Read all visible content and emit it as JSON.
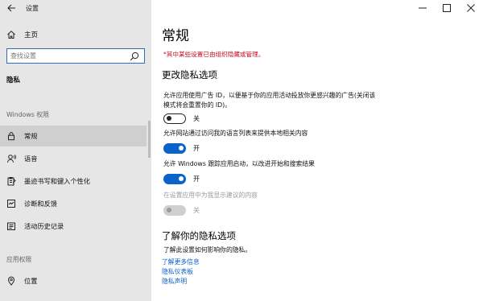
{
  "window": {
    "title": "设置"
  },
  "sidebar": {
    "home_label": "主页",
    "search_placeholder": "查找设置",
    "section_title": "隐私",
    "group1_label": "Windows 权限",
    "group1_items": [
      {
        "label": "常规",
        "icon": "lock-icon",
        "selected": true
      },
      {
        "label": "语音",
        "icon": "speech-icon",
        "selected": false
      },
      {
        "label": "墨迹书写和键入个性化",
        "icon": "pen-clipboard-icon",
        "selected": false
      },
      {
        "label": "诊断和反馈",
        "icon": "diagnostics-icon",
        "selected": false
      },
      {
        "label": "活动历史记录",
        "icon": "history-icon",
        "selected": false
      }
    ],
    "group2_label": "应用权限",
    "group2_items": [
      {
        "label": "位置",
        "icon": "location-icon",
        "selected": false
      }
    ]
  },
  "main": {
    "title": "常规",
    "managed_note": "*其中某些设置已由组织隐藏或管理。",
    "change_section": "更改隐私选项",
    "options": [
      {
        "text": "允许应用使用广告 ID，以便基于你的应用活动投放你更感兴趣的广告(关闭该模式将会重置你的 ID)。",
        "state": "关",
        "on": false,
        "enabled": true
      },
      {
        "text": "允许网站通过访问我的语言列表来提供本地相关内容",
        "state": "开",
        "on": true,
        "enabled": true
      },
      {
        "text": "允许 Windows 跟踪应用启动，以改进开始和搜索结果",
        "state": "开",
        "on": true,
        "enabled": true
      },
      {
        "text": "在设置应用中为我显示建议的内容",
        "state": "关",
        "on": false,
        "enabled": false
      }
    ],
    "learn_section": "了解你的隐私选项",
    "learn_desc": "了解此设置如何影响你的隐私。",
    "links": [
      "了解更多信息",
      "隐私仪表板",
      "隐私声明"
    ]
  },
  "colors": {
    "accent": "#0a63c9",
    "warning": "#c50f1f",
    "sidebar_bg": "#e6e6e6"
  }
}
